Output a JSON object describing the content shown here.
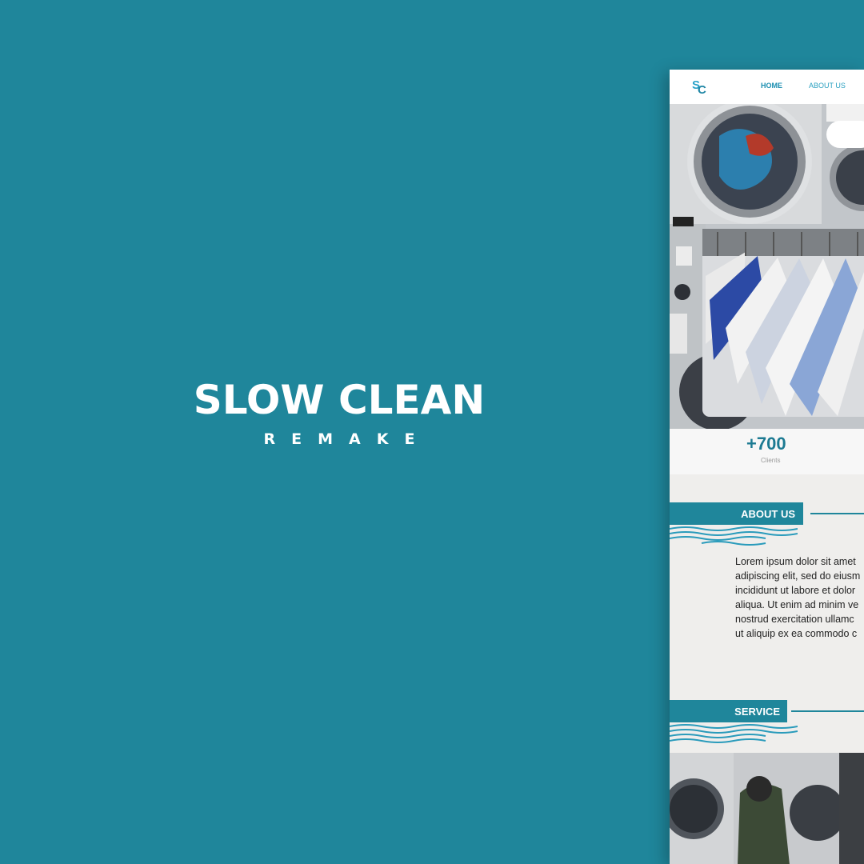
{
  "hero": {
    "title": "SLOW CLEAN",
    "subtitle": "REMAKE"
  },
  "colors": {
    "background": "#1f869b",
    "accent": "#1f869b",
    "nav_link": "#1a8eb0"
  },
  "mockup": {
    "logo": "SC",
    "nav": {
      "home": "HOME",
      "about": "ABOUT US"
    },
    "stats": {
      "value": "+700",
      "label": "Clients"
    },
    "about": {
      "heading": "ABOUT US",
      "lines": [
        "Lorem ipsum dolor sit amet",
        "adipiscing elit, sed do eiusm",
        "incididunt ut labore et dolor",
        "aliqua. Ut enim ad minim ve",
        "nostrud exercitation ullamc",
        "ut aliquip ex ea commodo c"
      ]
    },
    "service": {
      "heading": "SERVICE"
    },
    "icons": [
      "sc-logo-icon",
      "wave-icon"
    ]
  }
}
